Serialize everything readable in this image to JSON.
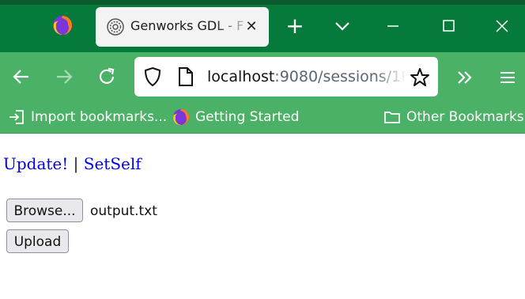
{
  "browser": {
    "tab": {
      "title": "Genworks GDL - F",
      "close_symbol": "✕"
    },
    "new_tab_symbol": "+",
    "url": {
      "host": "localhost",
      "rest": ":9080/sessions/1F"
    },
    "bookmarks": {
      "import": "Import bookmarks...",
      "getting_started": "Getting Started",
      "other": "Other Bookmarks"
    },
    "colors": {
      "titlebar": "#067a3a",
      "toolbar": "#4bb166"
    }
  },
  "page": {
    "update_link": "Update!",
    "separator": " | ",
    "setself_link": "SetSelf",
    "browse_button": "Browse...",
    "selected_file": "output.txt",
    "upload_button": "Upload"
  }
}
